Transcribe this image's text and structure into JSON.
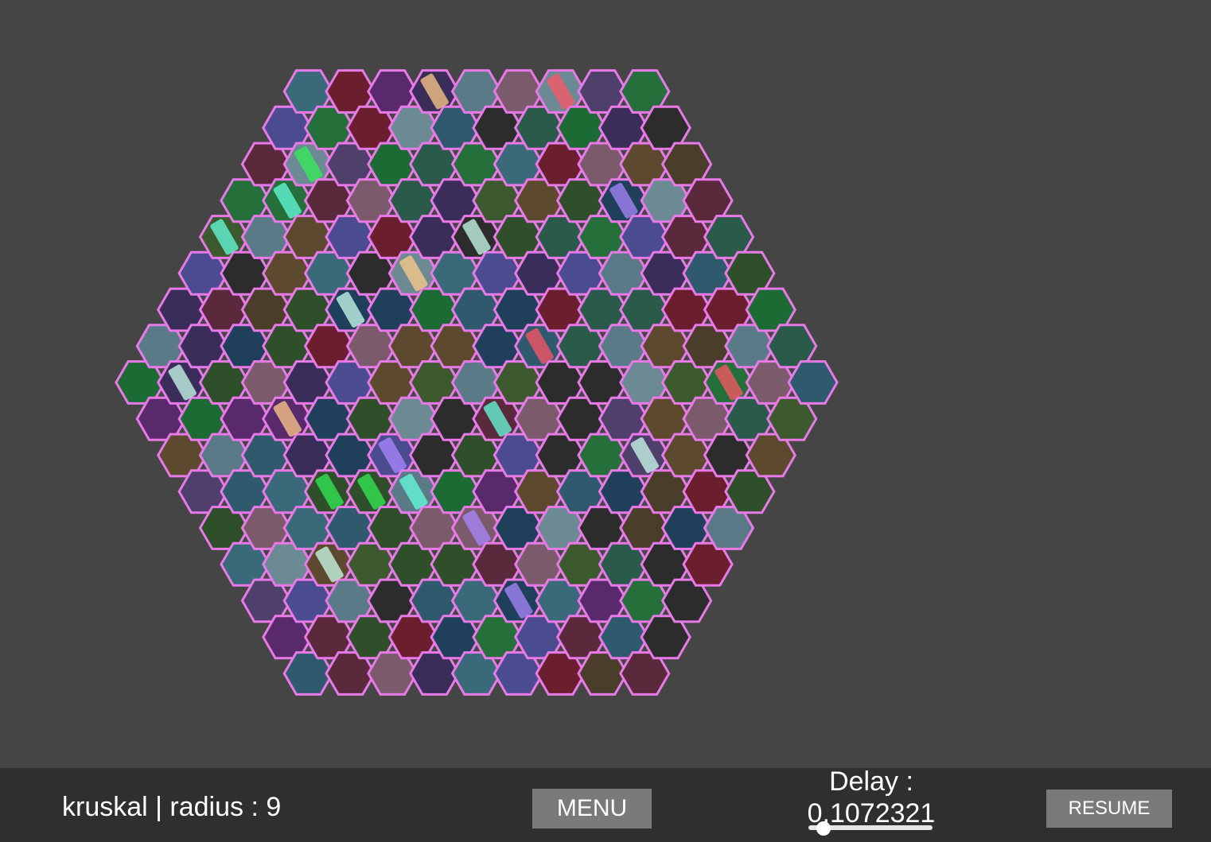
{
  "maze": {
    "algorithm": "kruskal",
    "radius": 9,
    "wall_color": "#e87ae8",
    "background_color": "#454545"
  },
  "bottom_bar": {
    "status_text": "kruskal | radius : 9",
    "menu_label": "MENU",
    "delay_label": "Delay :",
    "delay_value": "0,1072321",
    "delay_slider_fraction": 0.12,
    "resume_label": "RESUME"
  }
}
